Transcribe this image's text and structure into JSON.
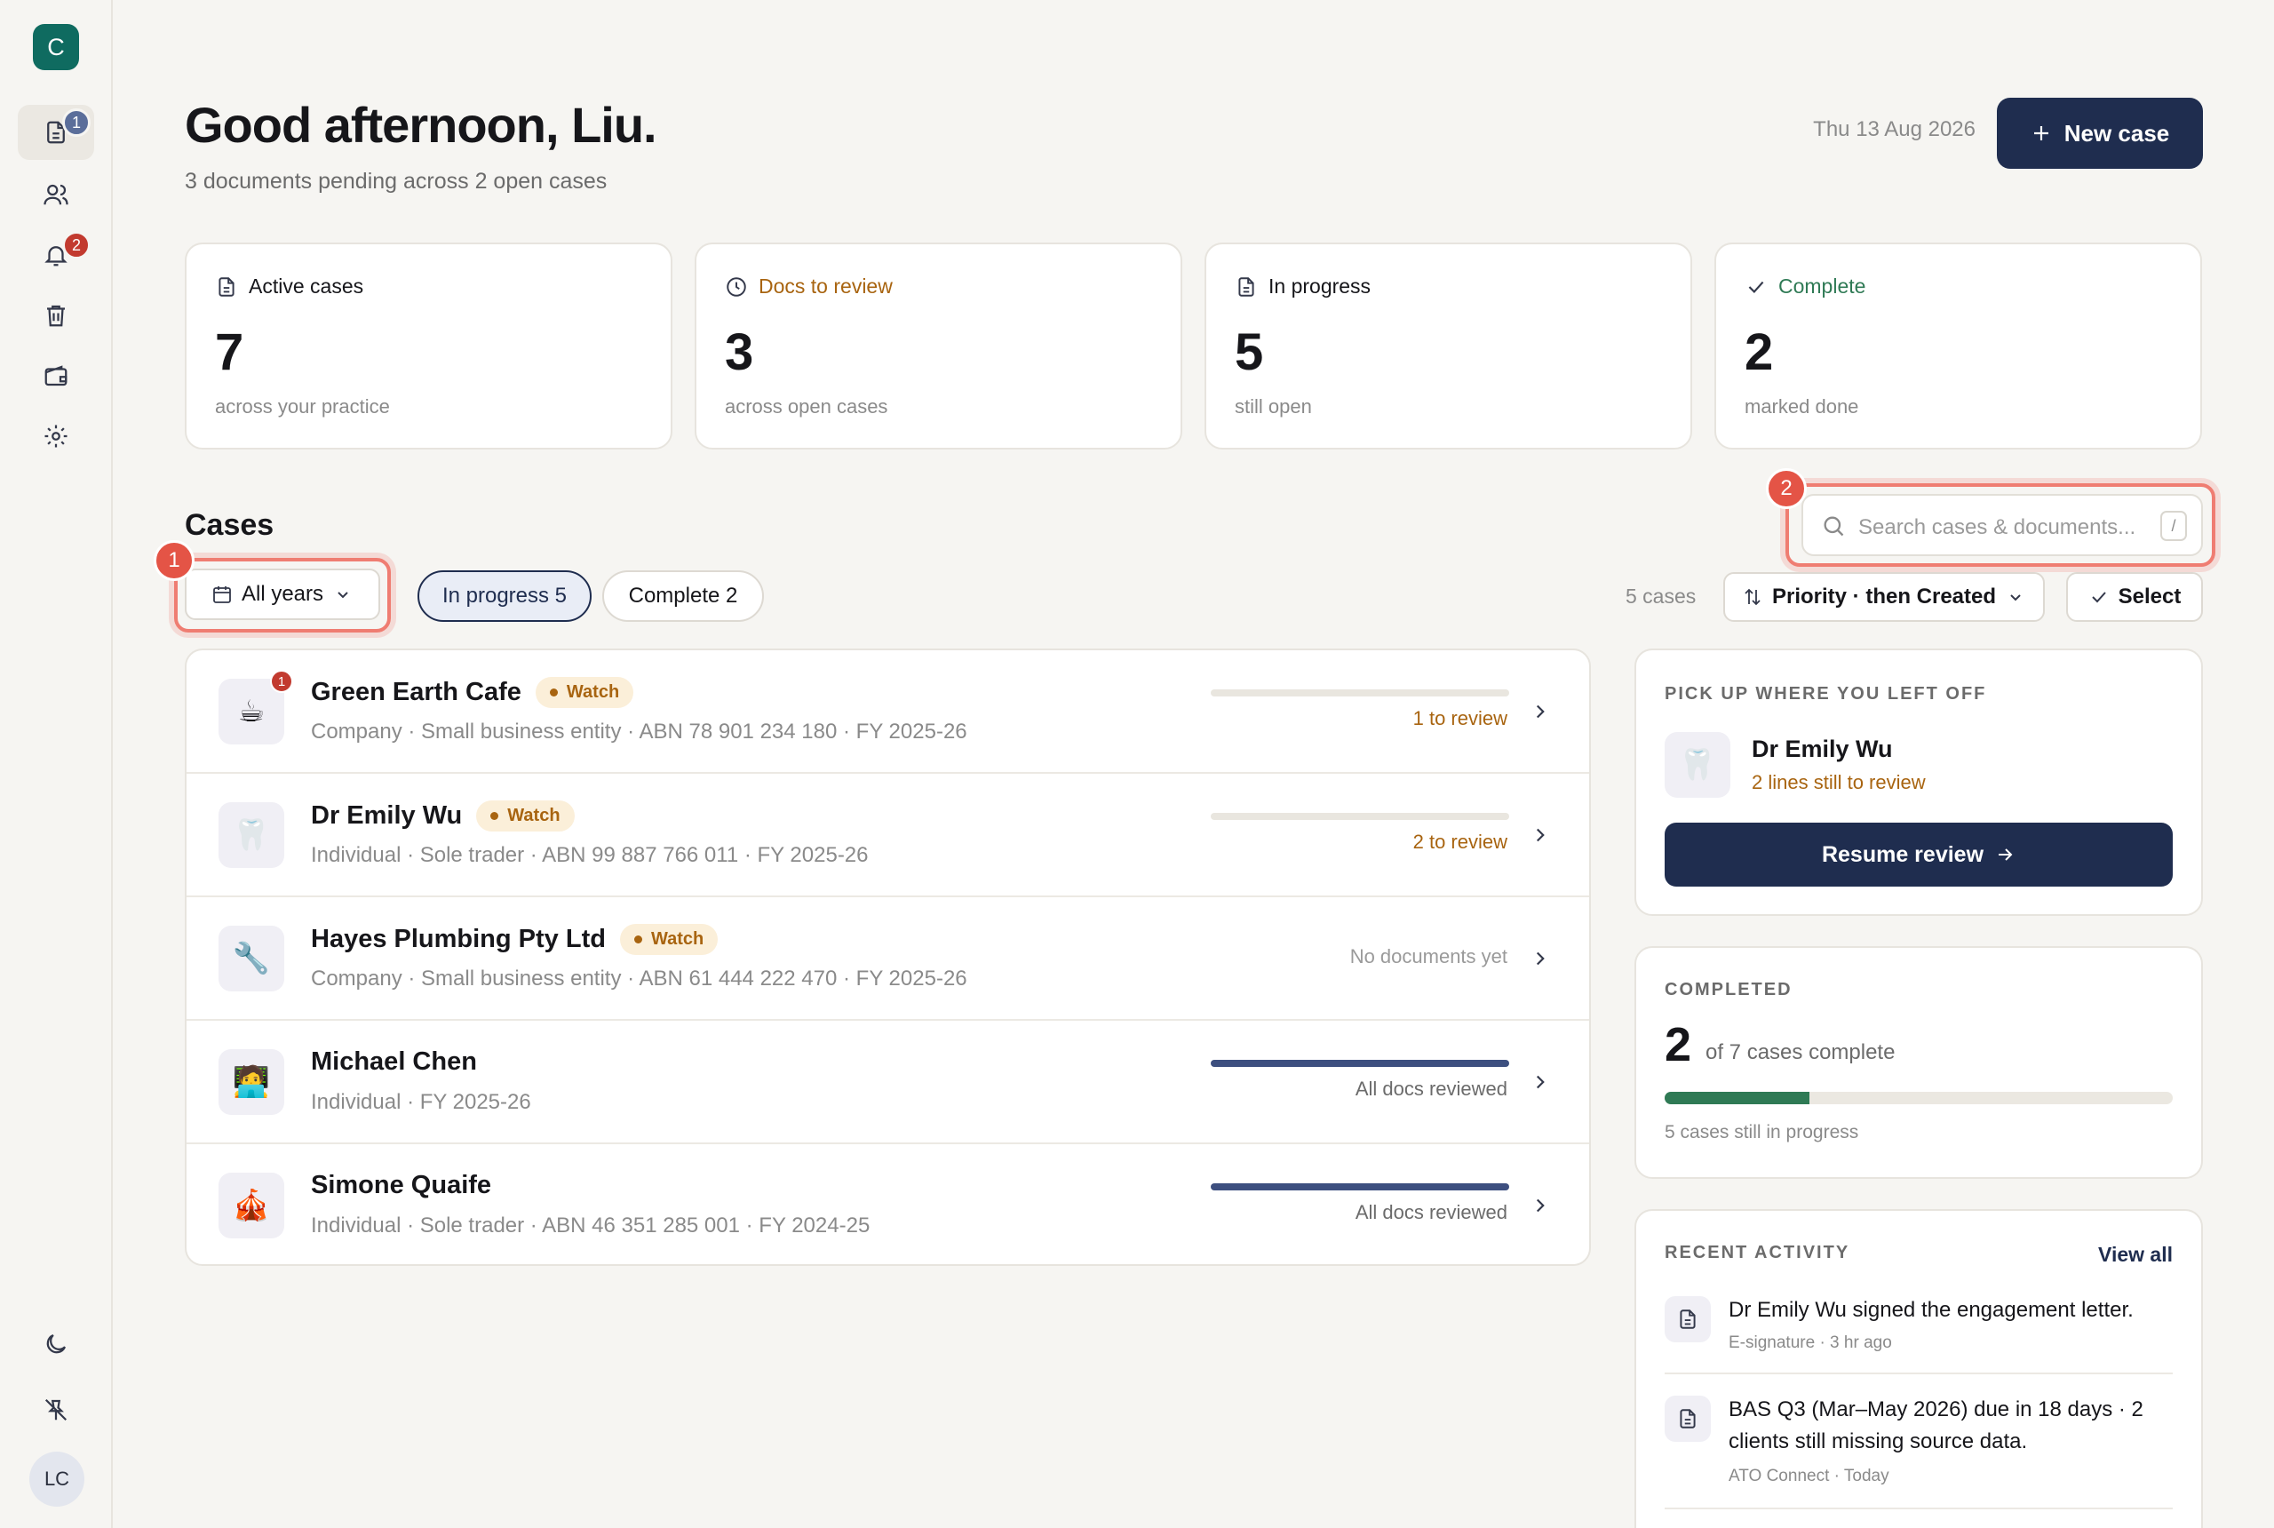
{
  "sidebar": {
    "logo": "C",
    "badges": {
      "cases": "1",
      "notifications": "2"
    },
    "avatar": "LC"
  },
  "header": {
    "title": "Good afternoon, Liu.",
    "subtitle": "3 documents pending across 2 open cases",
    "date": "Thu 13 Aug 2026",
    "new_case": "New case"
  },
  "stats": [
    {
      "label": "Active cases",
      "value": "7",
      "sub": "across your practice",
      "color": "#16161a"
    },
    {
      "label": "Docs to review",
      "value": "3",
      "sub": "across open cases",
      "color": "#a86410"
    },
    {
      "label": "In progress",
      "value": "5",
      "sub": "still open",
      "color": "#16161a"
    },
    {
      "label": "Complete",
      "value": "2",
      "sub": "marked done",
      "color": "#2f7a55"
    }
  ],
  "cases_section": {
    "title": "Cases",
    "search_placeholder": "Search cases & documents...",
    "search_shortcut": "/",
    "markers": [
      "1",
      "2"
    ],
    "filters": {
      "years": "All years",
      "in_progress": "In progress 5",
      "complete": "Complete 2"
    },
    "count": "5 cases",
    "sort": "Priority · then Created",
    "select": "Select"
  },
  "cases": [
    {
      "icon": "☕",
      "name": "Green Earth Cafe",
      "badge": "Watch",
      "alert": "1",
      "meta": "Company · Small business entity · ABN 78 901 234 180 · FY 2025-26",
      "status": "1 to review",
      "progress": 0
    },
    {
      "icon": "🦷",
      "name": "Dr Emily Wu",
      "badge": "Watch",
      "meta": "Individual · Sole trader · ABN 99 887 766 011 · FY 2025-26",
      "status": "2 to review",
      "progress": 0
    },
    {
      "icon": "🔧",
      "name": "Hayes Plumbing Pty Ltd",
      "badge": "Watch",
      "meta": "Company · Small business entity · ABN 61 444 222 470 · FY 2025-26",
      "status": "No documents yet"
    },
    {
      "icon": "🧑‍💻",
      "name": "Michael Chen",
      "meta": "Individual · FY 2025-26",
      "status": "All docs reviewed",
      "progress": 1
    },
    {
      "icon": "🎪",
      "name": "Simone Quaife",
      "meta": "Individual · Sole trader · ABN 46 351 285 001 · FY 2024-25",
      "status": "All docs reviewed",
      "progress": 1
    }
  ],
  "resume": {
    "caption": "PICK UP WHERE YOU LEFT OFF",
    "icon": "🦷",
    "name": "Dr Emily Wu",
    "sub": "2 lines still to review",
    "button": "Resume review"
  },
  "completed": {
    "caption": "COMPLETED",
    "value": "2",
    "of_text": "of 7 cases complete",
    "progress": 0.2857,
    "sub": "5 cases still in progress"
  },
  "activity": {
    "caption": "RECENT ACTIVITY",
    "view_all": "View all",
    "items": [
      {
        "text": "Dr Emily Wu signed the engagement letter.",
        "meta": "E-signature · 3 hr ago"
      },
      {
        "text": "BAS Q3 (Mar–May 2026) due in 18 days · 2 clients still missing source data.",
        "meta": "ATO Connect · Today"
      }
    ]
  }
}
